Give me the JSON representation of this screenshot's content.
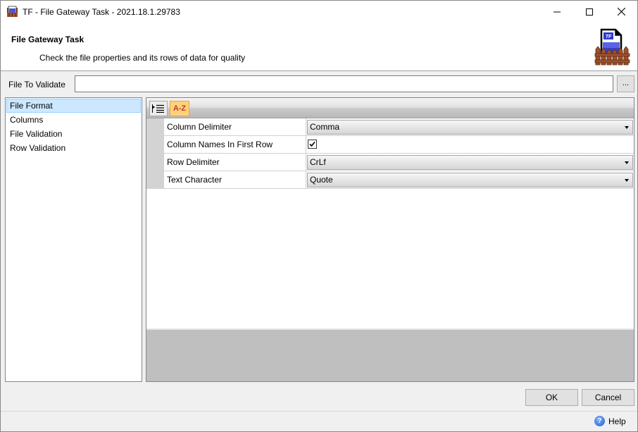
{
  "window": {
    "title": "TF - File Gateway Task - 2021.18.1.29783",
    "app_icon": "tf-package-icon",
    "controls": [
      "minimize-icon",
      "maximize-icon",
      "close-icon"
    ]
  },
  "header": {
    "title": "File Gateway Task",
    "subtitle": "Check the file properties and its rows of data for quality",
    "logo_text": "TF"
  },
  "file_to_validate": {
    "label": "File To Validate",
    "value": "",
    "browse_label": "..."
  },
  "nav": {
    "items": [
      {
        "label": "File Format",
        "selected": true
      },
      {
        "label": "Columns",
        "selected": false
      },
      {
        "label": "File Validation",
        "selected": false
      },
      {
        "label": "Row Validation",
        "selected": false
      }
    ]
  },
  "property_grid": {
    "toolbar": {
      "categorized_icon": "categorized-icon",
      "alphabetical_label": "A-Z"
    },
    "rows": [
      {
        "name": "Column Delimiter",
        "type": "combo",
        "value": "Comma"
      },
      {
        "name": "Column Names In First Row",
        "type": "checkbox",
        "checked": true
      },
      {
        "name": "Row Delimiter",
        "type": "combo",
        "value": "CrLf"
      },
      {
        "name": "Text Character",
        "type": "combo",
        "value": "Quote"
      }
    ]
  },
  "buttons": {
    "ok": "OK",
    "cancel": "Cancel"
  },
  "status": {
    "help_label": "Help",
    "help_icon": "help-icon"
  }
}
